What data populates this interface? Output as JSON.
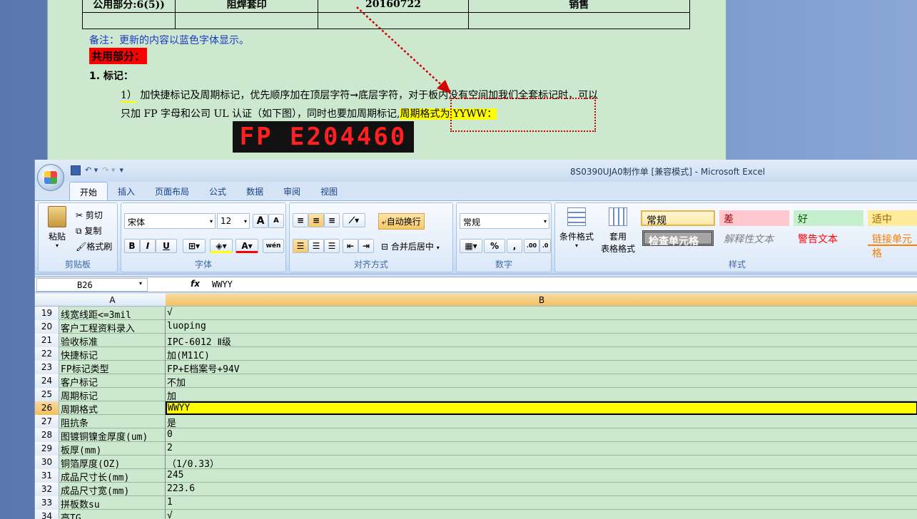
{
  "word": {
    "table_row": [
      "公用部分:6(5))",
      "阻焊套印",
      "20160722",
      "销售"
    ],
    "note": "备注：更新的内容以蓝色字体显示。",
    "shared": "共用部分：",
    "section1": "1.   标记：",
    "para_line1_a": "1）",
    "para_line1_b": " 加快捷标记及周期标记，优先顺序加在顶层字符",
    "para_line1_c": "→",
    "para_line1_d": "底层字符，对于板内没有空间加我们全套标记时，可以",
    "para_line2_a": "只加 FP 字母和公司 UL 认证（如下图），同时也要加周期标记,",
    "para_line2_hl": "周期格式为 YYWW：",
    "fp_image_text": "FP E204460"
  },
  "excel": {
    "title": "8S0390UJA0制作单  [兼容模式] - Microsoft Excel",
    "tabs": [
      "开始",
      "插入",
      "页面布局",
      "公式",
      "数据",
      "审阅",
      "视图"
    ],
    "clipboard": {
      "paste": "粘贴",
      "cut": "剪切",
      "copy": "复制",
      "format_painter": "格式刷",
      "label": "剪贴板"
    },
    "font": {
      "name": "宋体",
      "size": "12",
      "label": "字体",
      "bold": "B",
      "italic": "I",
      "underline": "U",
      "grow": "A",
      "shrink": "A",
      "wen": "wén"
    },
    "alignment": {
      "wrap": "自动换行",
      "merge": "合并后居中",
      "label": "对齐方式"
    },
    "number": {
      "format": "常规",
      "percent": "%",
      "comma": ",",
      "label": "数字"
    },
    "styles": {
      "conditional": "条件格式",
      "table_format_1": "套用",
      "table_format_2": "表格格式",
      "cells": [
        "常规",
        "差",
        "好",
        "适中",
        "检查单元格",
        "解释性文本",
        "警告文本",
        "链接单元格"
      ],
      "label": "样式"
    },
    "name_box": "B26",
    "fx": "fx",
    "formula": "WWYY",
    "columns": [
      "A",
      "B"
    ],
    "rows": [
      {
        "n": "19",
        "a": "线宽线距<=3mil",
        "b": "√"
      },
      {
        "n": "20",
        "a": "客户工程资料录入",
        "b": "luoping"
      },
      {
        "n": "21",
        "a": "验收标准",
        "b": "IPC-6012 Ⅱ级"
      },
      {
        "n": "22",
        "a": "快捷标记",
        "b": "加(M11C)"
      },
      {
        "n": "23",
        "a": "FP标记类型",
        "b": "FP+E档案号+94V"
      },
      {
        "n": "24",
        "a": "客户标记",
        "b": "不加"
      },
      {
        "n": "25",
        "a": "周期标记",
        "b": "加"
      },
      {
        "n": "26",
        "a": "周期格式",
        "b": "WWYY"
      },
      {
        "n": "27",
        "a": "阻抗条",
        "b": "是"
      },
      {
        "n": "28",
        "a": "图镀铜镍金厚度(um)",
        "b": "0"
      },
      {
        "n": "29",
        "a": "板厚(mm)",
        "b": "2"
      },
      {
        "n": "30",
        "a": "铜箔厚度(OZ)",
        "b": "（1/0.33）"
      },
      {
        "n": "31",
        "a": "成品尺寸长(mm)",
        "b": "245"
      },
      {
        "n": "32",
        "a": "成品尺寸宽(mm)",
        "b": "223.6"
      },
      {
        "n": "33",
        "a": "拼板数su",
        "b": "1"
      },
      {
        "n": "34",
        "a": "高TG",
        "b": "√"
      }
    ]
  }
}
